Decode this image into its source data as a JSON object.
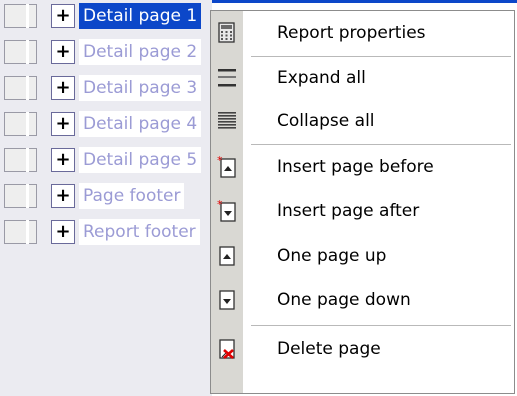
{
  "tree": {
    "rows": [
      {
        "label": "Detail page 1",
        "selected": true
      },
      {
        "label": "Detail page 2"
      },
      {
        "label": "Detail page 3"
      },
      {
        "label": "Detail page 4"
      },
      {
        "label": "Detail page 5"
      },
      {
        "label": "Page footer"
      },
      {
        "label": "Report footer"
      }
    ],
    "expand_symbol": "+"
  },
  "menu": {
    "items": [
      {
        "label": "Report properties",
        "icon": "report-properties-icon"
      },
      {
        "label": "Expand all",
        "icon": "expand-all-icon"
      },
      {
        "label": "Collapse all",
        "icon": "collapse-all-icon"
      },
      {
        "label": "Insert page before",
        "icon": "insert-page-before-icon"
      },
      {
        "label": "Insert page after",
        "icon": "insert-page-after-icon"
      },
      {
        "label": "One page up",
        "icon": "page-up-icon"
      },
      {
        "label": "One page down",
        "icon": "page-down-icon"
      },
      {
        "label": "Delete page",
        "icon": "delete-page-icon"
      }
    ]
  },
  "colors": {
    "selection": "#0c47c9",
    "tree_background": "#ebebf1",
    "menu_strip": "#d9d8d3",
    "dim_label": "#9b9bd5"
  }
}
